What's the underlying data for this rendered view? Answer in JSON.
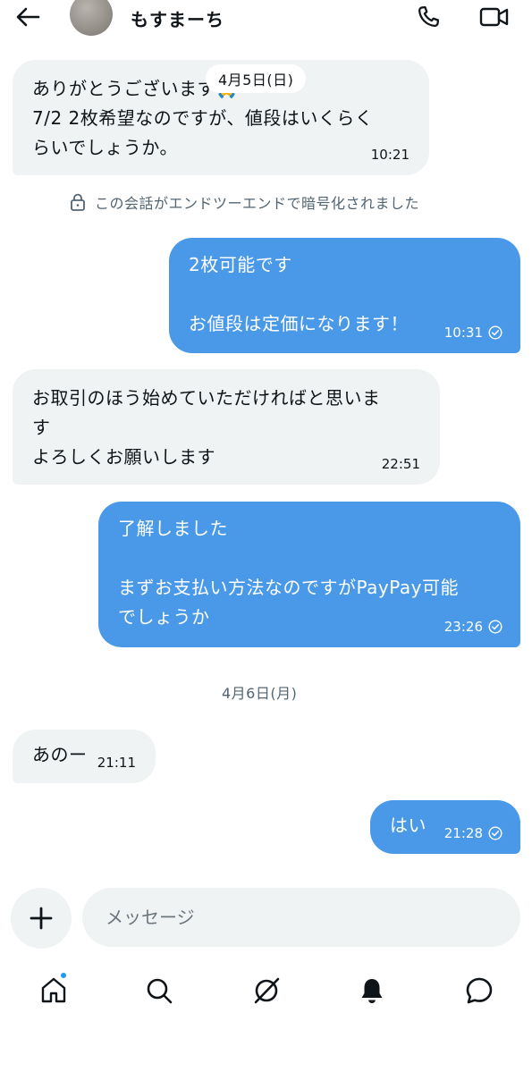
{
  "header": {
    "contact_name": "もすまーち",
    "back_icon": "arrow-left-icon",
    "call_icon": "phone-icon",
    "video_icon": "video-camera-icon"
  },
  "messages": {
    "m1": {
      "lines": [
        "ありがとうございます🙏",
        "7/2 2枚希望なのですが、値段はいくらく",
        "らいでしょうか。"
      ],
      "time": "10:21",
      "direction": "incoming"
    },
    "date1": "4月5日(日)",
    "e2e_notice": "この会話がエンドツーエンドで暗号化されました",
    "m2": {
      "lines": [
        "2枚可能です",
        "",
        "お値段は定価になります！"
      ],
      "time": "10:31",
      "direction": "outgoing"
    },
    "m3": {
      "lines": [
        "お取引のほう始めていただければと思いま",
        "す",
        "よろしくお願いします"
      ],
      "time": "22:51",
      "direction": "incoming"
    },
    "m4": {
      "lines": [
        "了解しました",
        "",
        "まずお支払い方法なのですがPayPay可能",
        "でしょうか"
      ],
      "time": "23:26",
      "direction": "outgoing"
    },
    "date2": "4月6日(月)",
    "m5": {
      "lines": [
        "あのー"
      ],
      "time": "21:11",
      "direction": "incoming"
    },
    "m6": {
      "lines": [
        "はい"
      ],
      "time": "21:28",
      "direction": "outgoing"
    }
  },
  "composer": {
    "placeholder": "メッセージ",
    "add_icon": "plus-icon"
  },
  "nav": {
    "items": [
      "home-icon",
      "search-icon",
      "grok-icon",
      "notifications-bell-icon",
      "messages-icon"
    ],
    "notification_dot_color": "#1d9bf0"
  },
  "colors": {
    "outgoing_bubble": "#4a99e9",
    "incoming_bubble": "#eff3f4"
  }
}
